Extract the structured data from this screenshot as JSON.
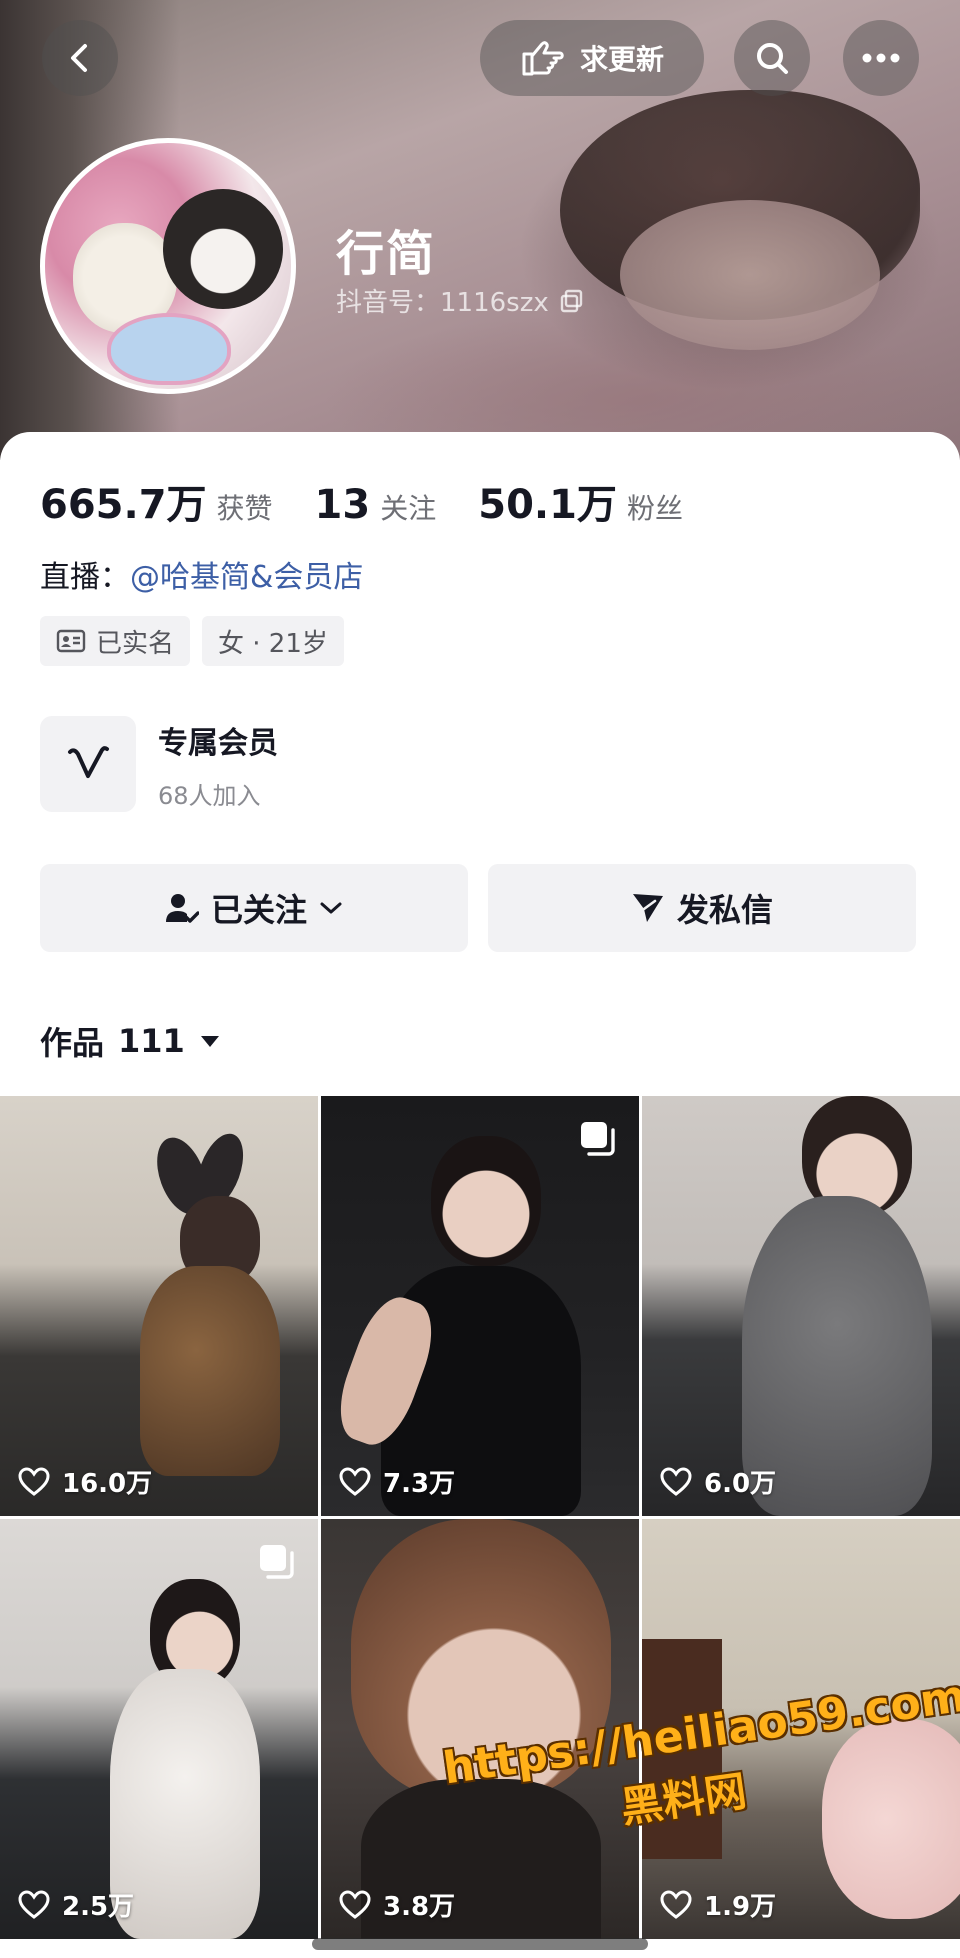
{
  "nav": {
    "request_update_label": "求更新"
  },
  "profile": {
    "name": "行简",
    "douyin_id": "抖音号：1116szx"
  },
  "stats": [
    {
      "value": "665.7万",
      "label": "获赞"
    },
    {
      "value": "13",
      "label": "关注"
    },
    {
      "value": "50.1万",
      "label": "粉丝"
    }
  ],
  "live": {
    "prefix": "直播：",
    "link": "@哈基简&会员店"
  },
  "tags": {
    "verified": "已实名",
    "gender_age": "女 · 21岁"
  },
  "membership": {
    "title": "专属会员",
    "subtitle": "68人加入"
  },
  "actions": {
    "following": "已关注",
    "message": "发私信"
  },
  "works": {
    "label": "作品",
    "count": "111"
  },
  "videos": [
    {
      "likes": "16.0万",
      "multi": false
    },
    {
      "likes": "7.3万",
      "multi": true
    },
    {
      "likes": "6.0万",
      "multi": false
    },
    {
      "likes": "2.5万",
      "multi": true
    },
    {
      "likes": "3.8万",
      "multi": false
    },
    {
      "likes": "1.9万",
      "multi": false
    }
  ],
  "watermark": {
    "url": "https://heiliao59.com",
    "site": "黑料网"
  },
  "icons": {
    "back": "chevron-left-icon",
    "request": "hand-pointing-icon",
    "search": "search-icon",
    "more": "more-horizontal-icon",
    "copy": "copy-icon",
    "id_card": "id-card-icon",
    "member": "v-logo-icon",
    "follow": "user-check-icon",
    "dropdown": "chevron-down-icon",
    "send": "send-icon",
    "caret": "caret-down-icon",
    "heart": "heart-icon",
    "multi": "multi-image-icon"
  },
  "colors": {
    "link": "#3d5fa6",
    "button_bg": "#f2f2f4",
    "watermark": "#ffb019"
  }
}
